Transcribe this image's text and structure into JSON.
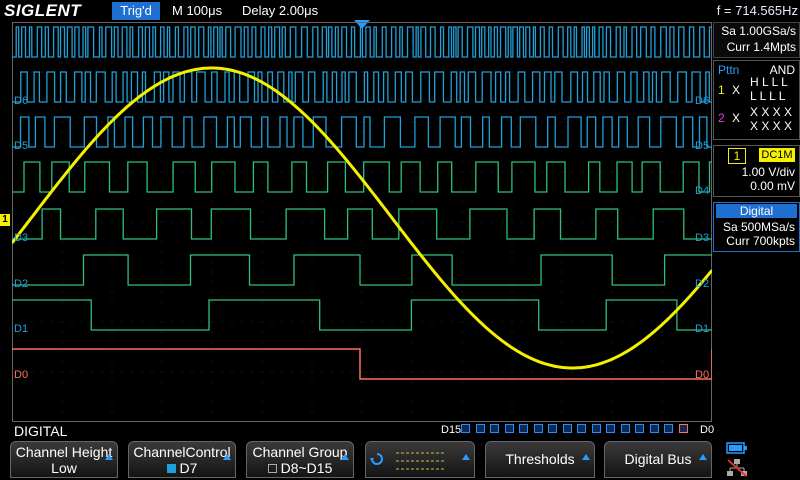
{
  "header": {
    "logo": "SIGLENT",
    "trigger_status": "Trig'd",
    "timebase": "M 100μs",
    "delay": "Delay 2.00μs",
    "frequency": "f = 714.565Hz"
  },
  "acquisition": {
    "sample_rate": "Sa 1.00GSa/s",
    "memory": "Curr 1.4Mpts"
  },
  "pattern_trigger": {
    "title": "Pttn",
    "mode": "AND",
    "rows": [
      {
        "ch": "1",
        "level": "X",
        "bits": [
          "H L L L",
          "L L L L"
        ]
      },
      {
        "ch": "2",
        "level": "X",
        "bits": [
          "X X X X",
          "X X X X"
        ]
      }
    ]
  },
  "channel1": {
    "number": "1",
    "coupling": "DC1M",
    "scale": "1.00 V/div",
    "offset": "0.00 mV"
  },
  "digital_panel": {
    "title": "Digital",
    "sample_rate": "Sa 500MSa/s",
    "memory": "Curr 700kpts"
  },
  "waveform": {
    "digital_channels": [
      "D6",
      "D5",
      "D4",
      "D3",
      "D2",
      "D1",
      "D0"
    ],
    "d7_label": "D7",
    "ch1_marker": "1"
  },
  "digital_bar": {
    "label": "DIGITAL",
    "high": "D15",
    "low": "D0"
  },
  "softkeys": [
    {
      "line1": "Channel Height",
      "line2": "Low"
    },
    {
      "line1": "ChannelControl",
      "line2": "D7"
    },
    {
      "line1": "Channel Group",
      "line2": "D8~D15"
    },
    {
      "line1": "",
      "line2": ""
    },
    {
      "line1": "Thresholds",
      "line2": ""
    },
    {
      "line1": "Digital Bus",
      "line2": ""
    }
  ],
  "colors": {
    "ch1": "#f5f000",
    "digital_high": "#1fa0d8",
    "digital_mid": "#2fbf7a",
    "d0": "#ff6f5f",
    "accent": "#1e6fd0"
  }
}
